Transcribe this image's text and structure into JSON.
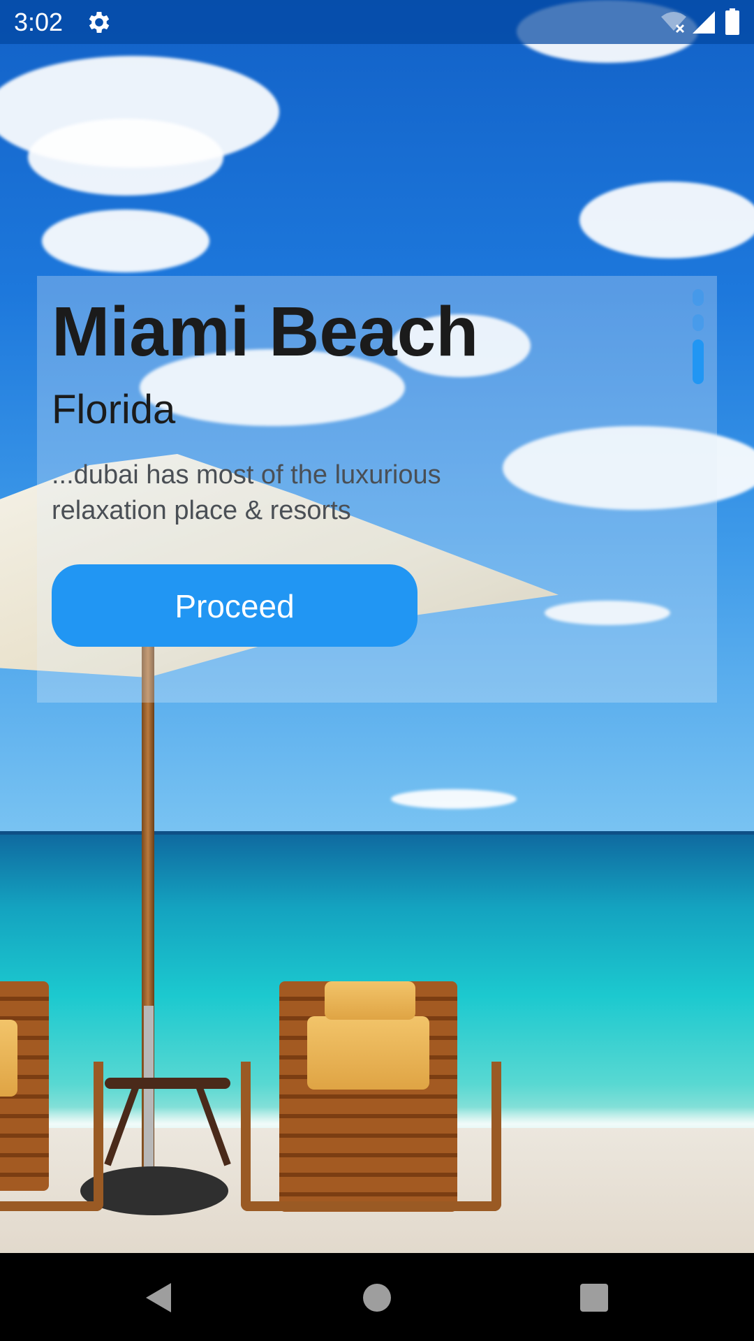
{
  "status_bar": {
    "time": "3:02",
    "icons": [
      "settings-icon",
      "wifi-off-icon",
      "signal-icon",
      "battery-icon"
    ]
  },
  "card": {
    "title": "Miami Beach",
    "subtitle": "Florida",
    "description": "...dubai has most of the luxurious relaxation place & resorts",
    "button_label": "Proceed",
    "pager": {
      "count": 3,
      "active_index": 2
    }
  },
  "nav_bar": {
    "icons": [
      "back-icon",
      "home-icon",
      "recents-icon"
    ]
  },
  "colors": {
    "accent": "#2196f3",
    "title_text": "#1b1b1b",
    "status_bar": "#0246a0"
  }
}
